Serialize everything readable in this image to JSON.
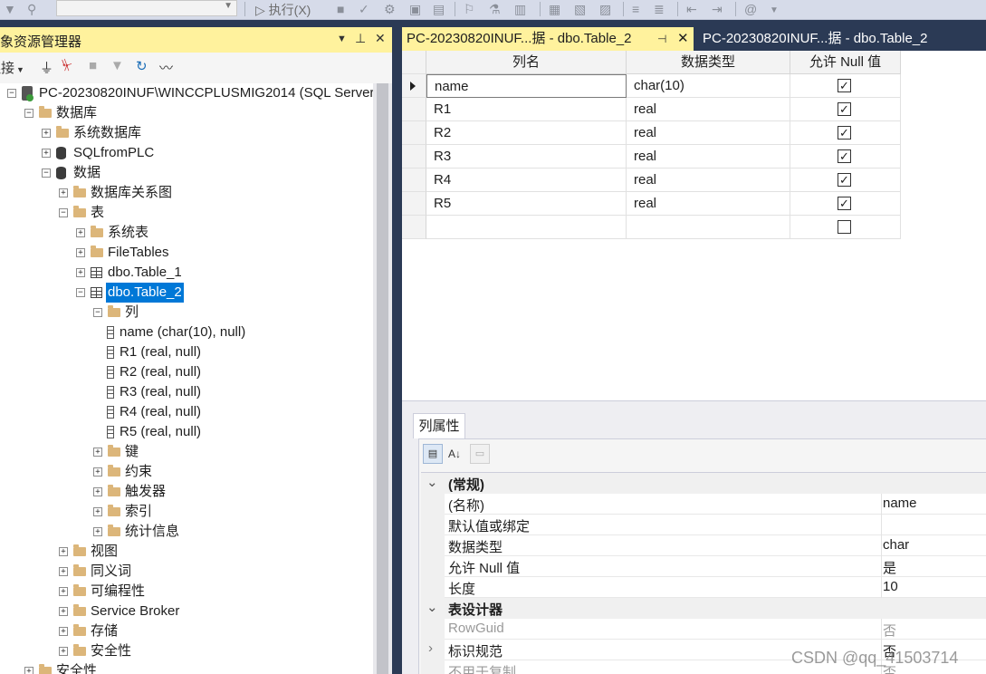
{
  "toolbar": {
    "execute_label": "执行(X)"
  },
  "object_explorer": {
    "title": "象资源管理器",
    "pin_label": "▾ ꟷ ✕",
    "connect_label": "连接",
    "tree": [
      {
        "label": "PC-20230820INUF\\WINCCPLUSMIG2014 (SQL Server",
        "icon": "server-icon",
        "level": 0,
        "expander": "-"
      },
      {
        "label": "数据库",
        "icon": "folder-icon",
        "level": 1,
        "expander": "-"
      },
      {
        "label": "系统数据库",
        "icon": "folder-icon",
        "level": 2,
        "expander": "+"
      },
      {
        "label": "SQLfromPLC",
        "icon": "database-icon",
        "level": 2,
        "expander": "+"
      },
      {
        "label": "数据",
        "icon": "database-icon",
        "level": 2,
        "expander": "-"
      },
      {
        "label": "数据库关系图",
        "icon": "folder-icon",
        "level": 3,
        "expander": "+"
      },
      {
        "label": "表",
        "icon": "folder-icon",
        "level": 3,
        "expander": "-"
      },
      {
        "label": "系统表",
        "icon": "folder-icon",
        "level": 4,
        "expander": "+"
      },
      {
        "label": "FileTables",
        "icon": "folder-icon",
        "level": 4,
        "expander": "+"
      },
      {
        "label": "dbo.Table_1",
        "icon": "table-icon",
        "level": 4,
        "expander": "+"
      },
      {
        "label": "dbo.Table_2",
        "icon": "table-icon",
        "level": 4,
        "expander": "-",
        "selected": true
      },
      {
        "label": "列",
        "icon": "folder-icon",
        "level": 5,
        "expander": "-"
      },
      {
        "label": "name (char(10), null)",
        "icon": "column-icon",
        "level": 6,
        "expander": ""
      },
      {
        "label": "R1 (real, null)",
        "icon": "column-icon",
        "level": 6,
        "expander": ""
      },
      {
        "label": "R2 (real, null)",
        "icon": "column-icon",
        "level": 6,
        "expander": ""
      },
      {
        "label": "R3 (real, null)",
        "icon": "column-icon",
        "level": 6,
        "expander": ""
      },
      {
        "label": "R4 (real, null)",
        "icon": "column-icon",
        "level": 6,
        "expander": ""
      },
      {
        "label": "R5 (real, null)",
        "icon": "column-icon",
        "level": 6,
        "expander": ""
      },
      {
        "label": "键",
        "icon": "folder-icon",
        "level": 5,
        "expander": "+"
      },
      {
        "label": "约束",
        "icon": "folder-icon",
        "level": 5,
        "expander": "+"
      },
      {
        "label": "触发器",
        "icon": "folder-icon",
        "level": 5,
        "expander": "+"
      },
      {
        "label": "索引",
        "icon": "folder-icon",
        "level": 5,
        "expander": "+"
      },
      {
        "label": "统计信息",
        "icon": "folder-icon",
        "level": 5,
        "expander": "+"
      },
      {
        "label": "视图",
        "icon": "folder-icon",
        "level": 3,
        "expander": "+"
      },
      {
        "label": "同义词",
        "icon": "folder-icon",
        "level": 3,
        "expander": "+"
      },
      {
        "label": "可编程性",
        "icon": "folder-icon",
        "level": 3,
        "expander": "+"
      },
      {
        "label": "Service Broker",
        "icon": "folder-icon",
        "level": 3,
        "expander": "+"
      },
      {
        "label": "存储",
        "icon": "folder-icon",
        "level": 3,
        "expander": "+"
      },
      {
        "label": "安全性",
        "icon": "folder-icon",
        "level": 3,
        "expander": "+"
      },
      {
        "label": "安全性",
        "icon": "folder-icon",
        "level": 1,
        "expander": "+"
      }
    ]
  },
  "tabs": {
    "active": "PC-20230820INUF...据 - dbo.Table_2",
    "inactive": "PC-20230820INUF...据 - dbo.Table_2"
  },
  "designer": {
    "headers": [
      "列名",
      "数据类型",
      "允许 Null 值"
    ],
    "rows": [
      {
        "name": "name",
        "type": "char(10)",
        "nullable": true
      },
      {
        "name": "R1",
        "type": "real",
        "nullable": true
      },
      {
        "name": "R2",
        "type": "real",
        "nullable": true
      },
      {
        "name": "R3",
        "type": "real",
        "nullable": true
      },
      {
        "name": "R4",
        "type": "real",
        "nullable": true
      },
      {
        "name": "R5",
        "type": "real",
        "nullable": true
      },
      {
        "name": "",
        "type": "",
        "nullable": false
      }
    ]
  },
  "properties": {
    "tab_label": "列属性",
    "categories": [
      {
        "name": "(常规)",
        "rows": [
          {
            "name": "(名称)",
            "value": "name"
          },
          {
            "name": "默认值或绑定",
            "value": ""
          },
          {
            "name": "数据类型",
            "value": "char"
          },
          {
            "name": "允许 Null 值",
            "value": "是"
          },
          {
            "name": "长度",
            "value": "10"
          }
        ]
      },
      {
        "name": "表设计器",
        "rows": [
          {
            "name": "RowGuid",
            "value": "否",
            "dim": true
          },
          {
            "name": "标识规范",
            "value": "否",
            "expandable": true
          },
          {
            "name": "不用于复制",
            "value": "否",
            "dim": true
          }
        ]
      }
    ]
  },
  "watermark": "CSDN @qq_41503714"
}
